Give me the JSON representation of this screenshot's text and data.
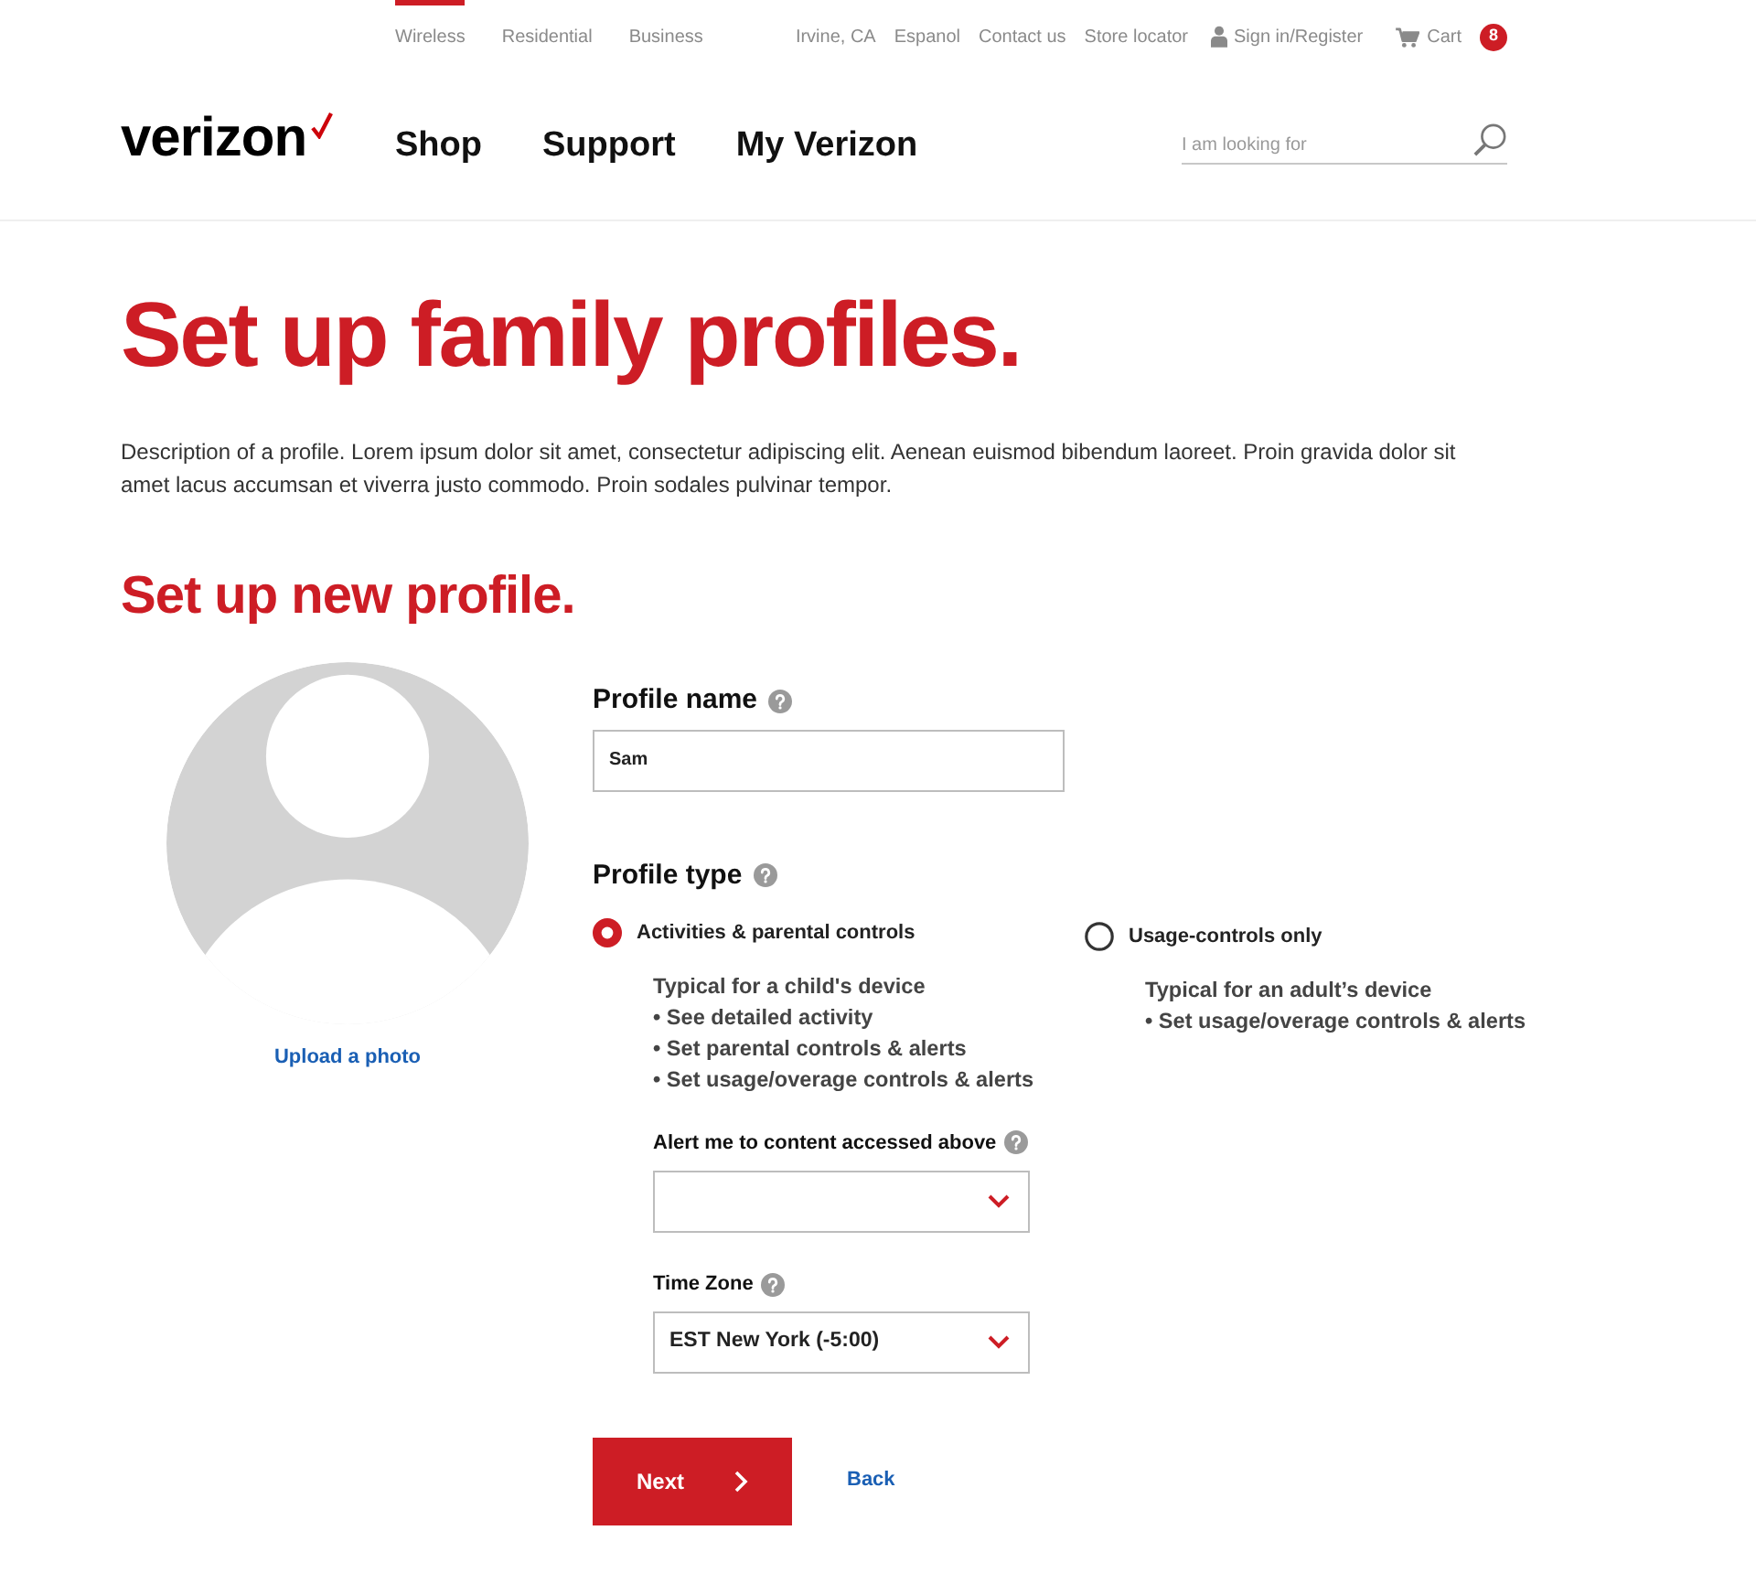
{
  "top_bar": {
    "segments": [
      {
        "label": "Wireless",
        "selected": true
      },
      {
        "label": "Residential",
        "selected": false
      },
      {
        "label": "Business",
        "selected": false
      }
    ],
    "links": [
      "Irvine, CA",
      "Espanol",
      "Contact us",
      "Store locator"
    ],
    "account": "Sign in/Register",
    "cart": {
      "label": "Cart",
      "count": "8"
    }
  },
  "header": {
    "logo": "verizon",
    "nav": [
      "Shop",
      "Support",
      "My Verizon"
    ],
    "search": {
      "placeholder": "I am looking for"
    }
  },
  "intro": {
    "title": "Set up family profiles.",
    "description": "Description of a profile. Lorem ipsum dolor sit amet, consectetur adipiscing elit. Aenean euismod bibendum laoreet. Proin gravida dolor sit amet lacus accumsan et viverra justo commodo. Proin sodales pulvinar tempor.",
    "section_title": "Set up new profile."
  },
  "photo": {
    "upload_link": "Upload a photo"
  },
  "form": {
    "profile_name": {
      "label": "Profile name",
      "value": "Sam"
    },
    "profile_type": {
      "label": "Profile type",
      "options": [
        {
          "label": "Activities & parental controls",
          "selected": true,
          "summary": "Typical for a child's device",
          "bullets": [
            "• See detailed activity",
            "• Set parental controls & alerts",
            "• Set usage/overage controls & alerts"
          ]
        },
        {
          "label": "Usage-controls only",
          "selected": false,
          "summary": "Typical for an adult’s device",
          "bullets": [
            "• Set usage/overage controls & alerts"
          ]
        }
      ]
    },
    "alert": {
      "label": "Alert me to content accessed above"
    },
    "time_zone": {
      "label": "Time Zone",
      "value": "EST New York (-5:00)"
    }
  },
  "actions": {
    "next": "Next",
    "back": "Back"
  }
}
